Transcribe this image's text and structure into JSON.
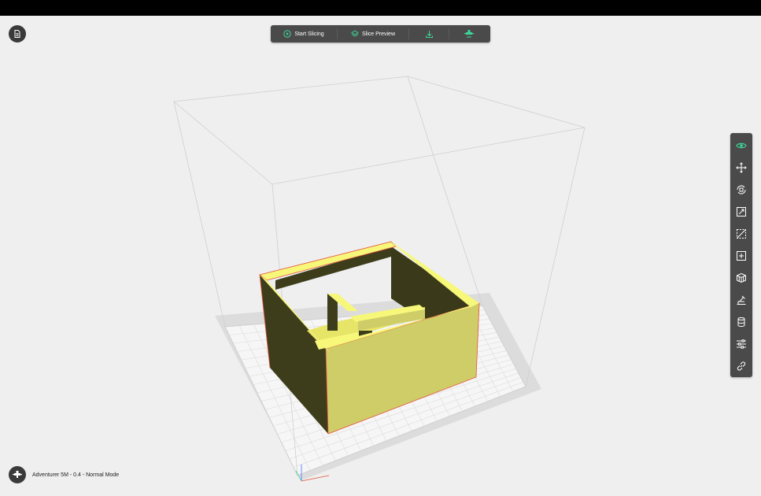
{
  "toolbar": {
    "start_slicing": "Start Slicing",
    "slice_preview": "Slice Preview",
    "export_icon": "download-icon",
    "print_icon": "printer-send-icon"
  },
  "right_tools": [
    {
      "name": "view-icon",
      "active": true
    },
    {
      "name": "move-icon"
    },
    {
      "name": "rotate-icon"
    },
    {
      "name": "scale-icon"
    },
    {
      "name": "cut-icon"
    },
    {
      "name": "add-object-icon"
    },
    {
      "name": "multi-object-icon"
    },
    {
      "name": "support-icon"
    },
    {
      "name": "cylinder-icon"
    },
    {
      "name": "settings-sliders-icon"
    },
    {
      "name": "link-icon"
    }
  ],
  "status": {
    "printer_info": "Adventurer 5M - 0.4 - Normal Mode"
  },
  "colors": {
    "accent": "#3ed598",
    "toolbar_bg": "#4a4a4a",
    "model_top": "#f7f77a",
    "model_side_light": "#cfcd68",
    "model_side_dark": "#3d3d1c",
    "model_edge": "#e5533c",
    "background": "#efefef"
  }
}
